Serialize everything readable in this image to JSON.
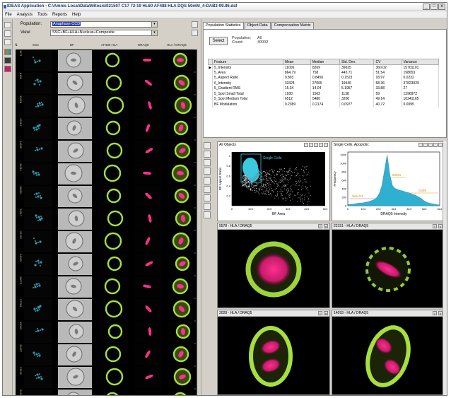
{
  "window": {
    "title": "IDEAS Application - C:\\Amnis Local\\Data\\Mitosis\\021507 C17 72-19 HL60 AF488 HLA DQS 50mM_4-DAB3-99.86.daf",
    "buttons": {
      "minimize": "_",
      "restore": "□",
      "close": "x"
    }
  },
  "menu": [
    "File",
    "Analysis",
    "Tools",
    "Reports",
    "Help"
  ],
  "left": {
    "population_label": "Population:",
    "population_value": "Anaphase CCD",
    "view_label": "View:",
    "view_value": "SSC+BF+HLA+Nucleus+Composite",
    "columns": [
      "SSC",
      "BF",
      "AF488 HLA",
      "DRAQ5",
      "HLA / DRAQ5"
    ],
    "row_ids": [
      "3571",
      "8184",
      "10528",
      "12013",
      "14265",
      "16311",
      "18052",
      "20517",
      "22151",
      "24062",
      "26073",
      "27518",
      "29062",
      "31007",
      "33119",
      "35201"
    ]
  },
  "right": {
    "tabs": [
      "Population Statistics",
      "Object Data",
      "Compensation Matrix"
    ],
    "active_tab": "Population Statistics",
    "select_button": "Select",
    "population_label": "Population:",
    "population_value": "All",
    "count_label": "Count:",
    "count_value": "40002",
    "table": {
      "headers": [
        "Feature",
        "Mean",
        "Median",
        "Std. Dev.",
        "CV",
        "Variance"
      ],
      "rows": [
        [
          "5_Intensity",
          "11006",
          "8269",
          "39625",
          "360.02",
          "15701101"
        ],
        [
          "5_Area",
          "864.79",
          "758",
          "445.71",
          "51.54",
          "198653"
        ],
        [
          "5_Aspect Ratio",
          "0.803",
          "0.8456",
          "0.1523",
          "18.97",
          "0.0232"
        ],
        [
          "6_Intensity",
          "33324",
          "27065",
          "19446",
          "58.36",
          "37823029"
        ],
        [
          "5_Gradient RMS",
          "15.34",
          "14.04",
          "5.1957",
          "33.88",
          "27"
        ],
        [
          "5_Spot Small Total",
          "1930",
          "1563",
          "1138",
          "59",
          "1296972"
        ],
        [
          "5_Spot Medium Total",
          "6512",
          "5480",
          "3200",
          "49.14",
          "10241165"
        ],
        [
          "BF Modulation",
          "0.2389",
          "0.2174",
          "0.0977",
          "40.72",
          "0.0095"
        ]
      ]
    },
    "plot1": {
      "title": "All Objects",
      "gate_label": "Single Cells",
      "xlabel": "BF Area",
      "ylabel": "BF Aspect Ratio",
      "xticks": [
        "0",
        "1e3",
        "2e3",
        "3e3",
        "4e3",
        "5e3"
      ],
      "yticks": [
        "0.2",
        "0.4",
        "0.6",
        "0.8",
        "1"
      ]
    },
    "plot2": {
      "title": "Single Cells, Apoptotic",
      "xlabel": "DRAQ5 Intensity",
      "ylabel": "Frequency",
      "xticks": [
        "0",
        "1e4",
        "2e4",
        "3e4",
        "4e4",
        "5e4",
        "6e4"
      ],
      "yticks": [
        "0",
        "200",
        "400",
        "600",
        "800",
        "1000",
        "1200"
      ],
      "labels": {
        "g0g1": "G0/G1",
        "g2m": "G2/M",
        "subg1": "Sub-G1"
      }
    },
    "images": [
      {
        "title": "5578 - HLA / DRAQ5",
        "kind": "metaphase"
      },
      {
        "title": "22151 - HLA / DRAQ5",
        "kind": "prophase"
      },
      {
        "title": "3028 - HLA / DRAQ5",
        "kind": "anaphase"
      },
      {
        "title": "14093 - HLA / DRAQ5",
        "kind": "telophase"
      }
    ]
  },
  "colors": {
    "hla_green": "#a6e040",
    "draq5_magenta": "#ff2f8e",
    "ssc_cyan": "#3ec8e0",
    "hist_fill": "#2fb0d0",
    "gate_label": "#ffd000"
  }
}
